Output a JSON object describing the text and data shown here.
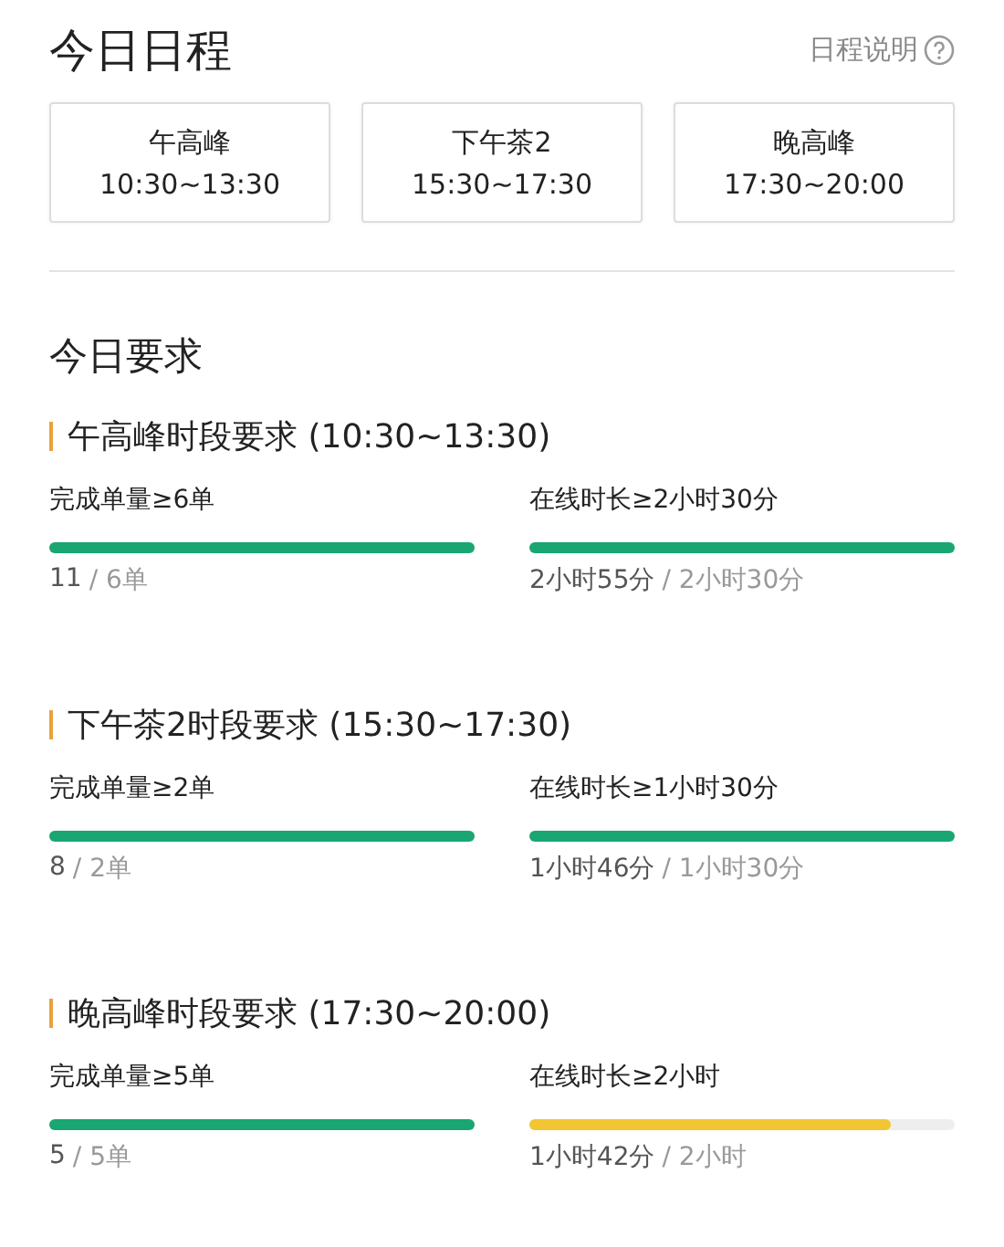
{
  "header": {
    "title": "今日日程",
    "help_link": "日程说明"
  },
  "schedule": [
    {
      "name": "午高峰",
      "time": "10:30~13:30"
    },
    {
      "name": "下午茶2",
      "time": "15:30~17:30"
    },
    {
      "name": "晚高峰",
      "time": "17:30~20:00"
    }
  ],
  "requirements_title": "今日要求",
  "sections": [
    {
      "title": "午高峰时段要求 (10:30~13:30)",
      "metrics": [
        {
          "label": "完成单量≥6单",
          "level": 1,
          "met": true,
          "current": "11",
          "goal": "/ 6单"
        },
        {
          "label": "在线时长≥2小时30分",
          "level": 1,
          "met": true,
          "current": "2小时55分",
          "goal": "/ 2小时30分"
        }
      ]
    },
    {
      "title": "下午茶2时段要求 (15:30~17:30)",
      "metrics": [
        {
          "label": "完成单量≥2单",
          "level": 1,
          "met": true,
          "current": "8",
          "goal": "/ 2单"
        },
        {
          "label": "在线时长≥1小时30分",
          "level": 1,
          "met": true,
          "current": "1小时46分",
          "goal": "/ 1小时30分"
        }
      ]
    },
    {
      "title": "晚高峰时段要求 (17:30~20:00)",
      "metrics": [
        {
          "label": "完成单量≥5单",
          "level": 1,
          "met": true,
          "current": "5",
          "goal": "/ 5单"
        },
        {
          "label": "在线时长≥2小时",
          "level": 0.85,
          "met": false,
          "current": "1小时42分",
          "goal": "/ 2小时"
        }
      ]
    }
  ]
}
